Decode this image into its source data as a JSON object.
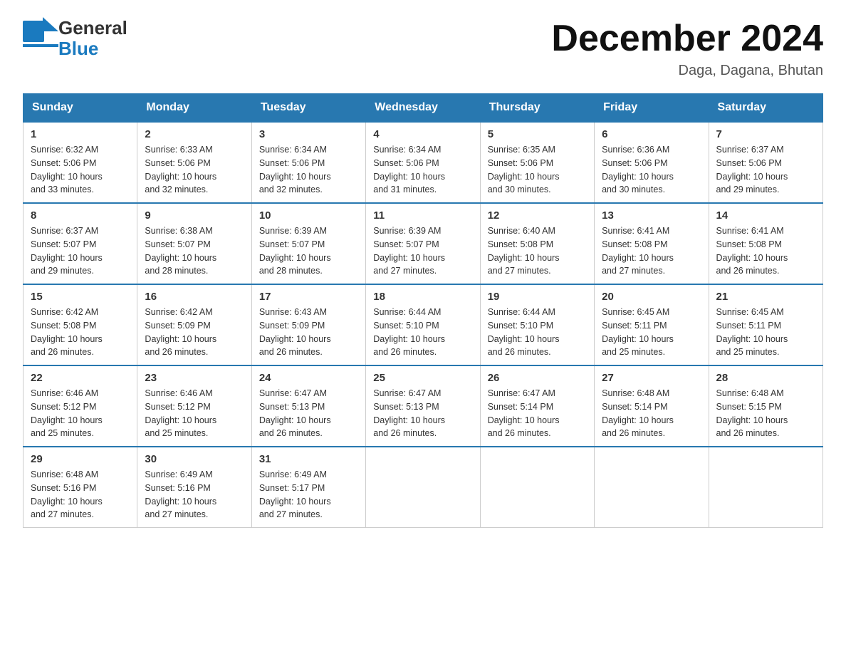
{
  "logo": {
    "general": "General",
    "blue": "Blue",
    "arrow": "▶"
  },
  "title": "December 2024",
  "location": "Daga, Dagana, Bhutan",
  "headers": [
    "Sunday",
    "Monday",
    "Tuesday",
    "Wednesday",
    "Thursday",
    "Friday",
    "Saturday"
  ],
  "weeks": [
    [
      {
        "day": "1",
        "sunrise": "6:32 AM",
        "sunset": "5:06 PM",
        "daylight": "10 hours and 33 minutes."
      },
      {
        "day": "2",
        "sunrise": "6:33 AM",
        "sunset": "5:06 PM",
        "daylight": "10 hours and 32 minutes."
      },
      {
        "day": "3",
        "sunrise": "6:34 AM",
        "sunset": "5:06 PM",
        "daylight": "10 hours and 32 minutes."
      },
      {
        "day": "4",
        "sunrise": "6:34 AM",
        "sunset": "5:06 PM",
        "daylight": "10 hours and 31 minutes."
      },
      {
        "day": "5",
        "sunrise": "6:35 AM",
        "sunset": "5:06 PM",
        "daylight": "10 hours and 30 minutes."
      },
      {
        "day": "6",
        "sunrise": "6:36 AM",
        "sunset": "5:06 PM",
        "daylight": "10 hours and 30 minutes."
      },
      {
        "day": "7",
        "sunrise": "6:37 AM",
        "sunset": "5:06 PM",
        "daylight": "10 hours and 29 minutes."
      }
    ],
    [
      {
        "day": "8",
        "sunrise": "6:37 AM",
        "sunset": "5:07 PM",
        "daylight": "10 hours and 29 minutes."
      },
      {
        "day": "9",
        "sunrise": "6:38 AM",
        "sunset": "5:07 PM",
        "daylight": "10 hours and 28 minutes."
      },
      {
        "day": "10",
        "sunrise": "6:39 AM",
        "sunset": "5:07 PM",
        "daylight": "10 hours and 28 minutes."
      },
      {
        "day": "11",
        "sunrise": "6:39 AM",
        "sunset": "5:07 PM",
        "daylight": "10 hours and 27 minutes."
      },
      {
        "day": "12",
        "sunrise": "6:40 AM",
        "sunset": "5:08 PM",
        "daylight": "10 hours and 27 minutes."
      },
      {
        "day": "13",
        "sunrise": "6:41 AM",
        "sunset": "5:08 PM",
        "daylight": "10 hours and 27 minutes."
      },
      {
        "day": "14",
        "sunrise": "6:41 AM",
        "sunset": "5:08 PM",
        "daylight": "10 hours and 26 minutes."
      }
    ],
    [
      {
        "day": "15",
        "sunrise": "6:42 AM",
        "sunset": "5:08 PM",
        "daylight": "10 hours and 26 minutes."
      },
      {
        "day": "16",
        "sunrise": "6:42 AM",
        "sunset": "5:09 PM",
        "daylight": "10 hours and 26 minutes."
      },
      {
        "day": "17",
        "sunrise": "6:43 AM",
        "sunset": "5:09 PM",
        "daylight": "10 hours and 26 minutes."
      },
      {
        "day": "18",
        "sunrise": "6:44 AM",
        "sunset": "5:10 PM",
        "daylight": "10 hours and 26 minutes."
      },
      {
        "day": "19",
        "sunrise": "6:44 AM",
        "sunset": "5:10 PM",
        "daylight": "10 hours and 26 minutes."
      },
      {
        "day": "20",
        "sunrise": "6:45 AM",
        "sunset": "5:11 PM",
        "daylight": "10 hours and 25 minutes."
      },
      {
        "day": "21",
        "sunrise": "6:45 AM",
        "sunset": "5:11 PM",
        "daylight": "10 hours and 25 minutes."
      }
    ],
    [
      {
        "day": "22",
        "sunrise": "6:46 AM",
        "sunset": "5:12 PM",
        "daylight": "10 hours and 25 minutes."
      },
      {
        "day": "23",
        "sunrise": "6:46 AM",
        "sunset": "5:12 PM",
        "daylight": "10 hours and 25 minutes."
      },
      {
        "day": "24",
        "sunrise": "6:47 AM",
        "sunset": "5:13 PM",
        "daylight": "10 hours and 26 minutes."
      },
      {
        "day": "25",
        "sunrise": "6:47 AM",
        "sunset": "5:13 PM",
        "daylight": "10 hours and 26 minutes."
      },
      {
        "day": "26",
        "sunrise": "6:47 AM",
        "sunset": "5:14 PM",
        "daylight": "10 hours and 26 minutes."
      },
      {
        "day": "27",
        "sunrise": "6:48 AM",
        "sunset": "5:14 PM",
        "daylight": "10 hours and 26 minutes."
      },
      {
        "day": "28",
        "sunrise": "6:48 AM",
        "sunset": "5:15 PM",
        "daylight": "10 hours and 26 minutes."
      }
    ],
    [
      {
        "day": "29",
        "sunrise": "6:48 AM",
        "sunset": "5:16 PM",
        "daylight": "10 hours and 27 minutes."
      },
      {
        "day": "30",
        "sunrise": "6:49 AM",
        "sunset": "5:16 PM",
        "daylight": "10 hours and 27 minutes."
      },
      {
        "day": "31",
        "sunrise": "6:49 AM",
        "sunset": "5:17 PM",
        "daylight": "10 hours and 27 minutes."
      },
      null,
      null,
      null,
      null
    ]
  ],
  "labels": {
    "sunrise": "Sunrise:",
    "sunset": "Sunset:",
    "daylight": "Daylight:"
  }
}
